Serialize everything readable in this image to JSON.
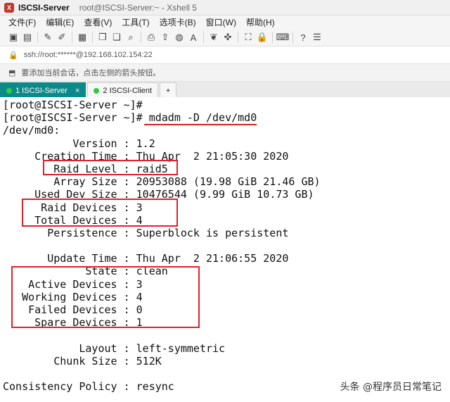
{
  "window": {
    "app_name": "ISCSI-Server",
    "subtitle": "root@ISCSI-Server:~ - Xshell 5"
  },
  "menu": [
    "文件(F)",
    "编辑(E)",
    "查看(V)",
    "工具(T)",
    "选项卡(B)",
    "窗口(W)",
    "帮助(H)"
  ],
  "address": {
    "text": "ssh://root:******@192.168.102.154:22"
  },
  "hint": {
    "text": "要添加当前会话，点击左侧的箭头按钮。"
  },
  "tabs": [
    {
      "label": "1 ISCSI-Server",
      "active": true,
      "dot_color": "#2ecc40"
    },
    {
      "label": "2 ISCSI-Client",
      "active": false,
      "dot_color": "#2ecc40"
    }
  ],
  "terminal": {
    "lines": [
      "[root@ISCSI-Server ~]#",
      "[root@ISCSI-Server ~]# mdadm -D /dev/md0",
      "/dev/md0:",
      "           Version : 1.2",
      "     Creation Time : Thu Apr  2 21:05:30 2020",
      "        Raid Level : raid5",
      "        Array Size : 20953088 (19.98 GiB 21.46 GB)",
      "     Used Dev Size : 10476544 (9.99 GiB 10.73 GB)",
      "      Raid Devices : 3",
      "     Total Devices : 4",
      "       Persistence : Superblock is persistent",
      "",
      "       Update Time : Thu Apr  2 21:06:55 2020",
      "             State : clean",
      "    Active Devices : 3",
      "   Working Devices : 4",
      "    Failed Devices : 0",
      "     Spare Devices : 1",
      "",
      "            Layout : left-symmetric",
      "        Chunk Size : 512K",
      "",
      "Consistency Policy : resync"
    ]
  },
  "watermark": "头条 @程序员日常笔记",
  "colors": {
    "highlight": "#e0202a",
    "tab_active": "#0c8a8a"
  }
}
